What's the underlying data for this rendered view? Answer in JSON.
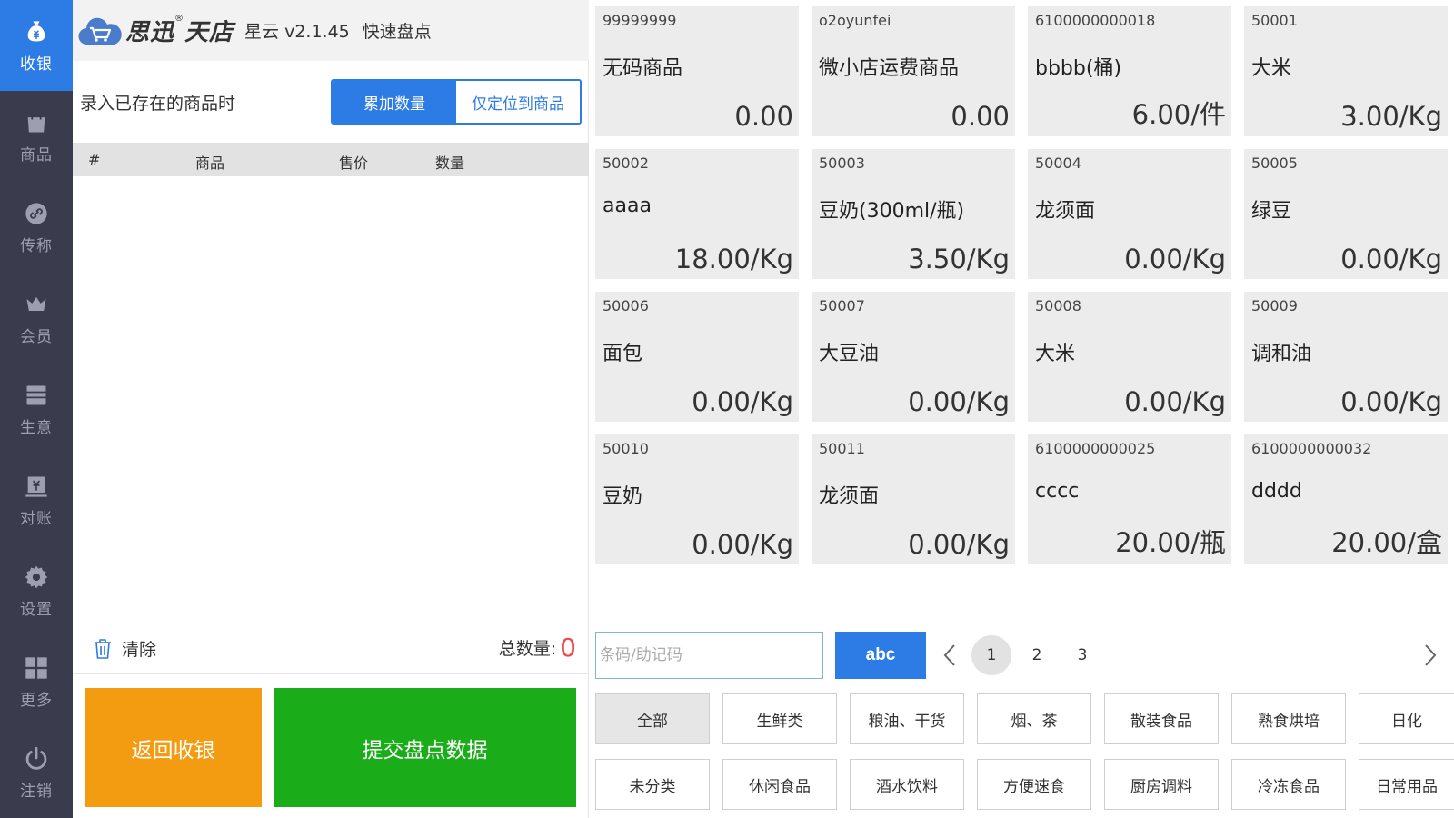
{
  "sidebar": {
    "items": [
      {
        "label": "收银",
        "icon": "money-bag-icon",
        "active": true
      },
      {
        "label": "商品",
        "icon": "shopping-bag-icon",
        "active": false
      },
      {
        "label": "传称",
        "icon": "link-icon",
        "active": false
      },
      {
        "label": "会员",
        "icon": "crown-icon",
        "active": false
      },
      {
        "label": "生意",
        "icon": "store-icon",
        "active": false
      },
      {
        "label": "对账",
        "icon": "ledger-icon",
        "active": false
      },
      {
        "label": "设置",
        "icon": "gear-icon",
        "active": false
      },
      {
        "label": "更多",
        "icon": "grid-icon",
        "active": false
      },
      {
        "label": "注销",
        "icon": "power-icon",
        "active": false
      }
    ]
  },
  "header": {
    "logo_text": "思迅",
    "logo_reg": "®",
    "logo_text2": "天店",
    "version": "星云 v2.1.45",
    "mode": "快速盘点"
  },
  "entry_mode": {
    "label": "录入已存在的商品时",
    "options": [
      "累加数量",
      "仅定位到商品"
    ],
    "selected": "累加数量"
  },
  "table": {
    "columns": [
      "#",
      "商品",
      "售价",
      "数量"
    ],
    "rows": []
  },
  "footer": {
    "clear_label": "清除",
    "total_label": "总数量:",
    "total_value": "0",
    "back_label": "返回收银",
    "submit_label": "提交盘点数据"
  },
  "products": [
    {
      "code": "99999999",
      "name": "无码商品",
      "price": "0.00"
    },
    {
      "code": "o2oyunfei",
      "name": "微小店运费商品",
      "price": "0.00"
    },
    {
      "code": "6100000000018",
      "name": "bbbb(桶)",
      "price": "6.00/件"
    },
    {
      "code": "50001",
      "name": "大米",
      "price": "3.00/Kg"
    },
    {
      "code": "50002",
      "name": "aaaa",
      "price": "18.00/Kg"
    },
    {
      "code": "50003",
      "name": "豆奶(300ml/瓶)",
      "price": "3.50/Kg"
    },
    {
      "code": "50004",
      "name": "龙须面",
      "price": "0.00/Kg"
    },
    {
      "code": "50005",
      "name": "绿豆",
      "price": "0.00/Kg"
    },
    {
      "code": "50006",
      "name": "面包",
      "price": "0.00/Kg"
    },
    {
      "code": "50007",
      "name": "大豆油",
      "price": "0.00/Kg"
    },
    {
      "code": "50008",
      "name": "大米",
      "price": "0.00/Kg"
    },
    {
      "code": "50009",
      "name": "调和油",
      "price": "0.00/Kg"
    },
    {
      "code": "50010",
      "name": "豆奶",
      "price": "0.00/Kg"
    },
    {
      "code": "50011",
      "name": "龙须面",
      "price": "0.00/Kg"
    },
    {
      "code": "6100000000025",
      "name": "cccc",
      "price": "20.00/瓶"
    },
    {
      "code": "6100000000032",
      "name": "dddd",
      "price": "20.00/盒"
    }
  ],
  "search": {
    "placeholder": "条码/助记码",
    "value": "",
    "keyboard_label": "abc"
  },
  "pagination": {
    "pages": [
      "1",
      "2",
      "3"
    ],
    "current": "1"
  },
  "categories": [
    {
      "label": "全部",
      "active": true
    },
    {
      "label": "生鲜类",
      "active": false
    },
    {
      "label": "粮油、干货",
      "active": false
    },
    {
      "label": "烟、茶",
      "active": false
    },
    {
      "label": "散装食品",
      "active": false
    },
    {
      "label": "熟食烘培",
      "active": false
    },
    {
      "label": "日化",
      "active": false
    },
    {
      "label": "未分类",
      "active": false
    },
    {
      "label": "休闲食品",
      "active": false
    },
    {
      "label": "酒水饮料",
      "active": false
    },
    {
      "label": "方便速食",
      "active": false
    },
    {
      "label": "厨房调料",
      "active": false
    },
    {
      "label": "冷冻食品",
      "active": false
    },
    {
      "label": "日常用品",
      "active": false
    }
  ],
  "colors": {
    "sidebar_bg": "#3a3b4c",
    "accent_blue": "#2d7be5",
    "back_orange": "#f39c12",
    "submit_green": "#1aad19",
    "total_red": "#f04a4a",
    "tile_bg": "#ececec"
  }
}
